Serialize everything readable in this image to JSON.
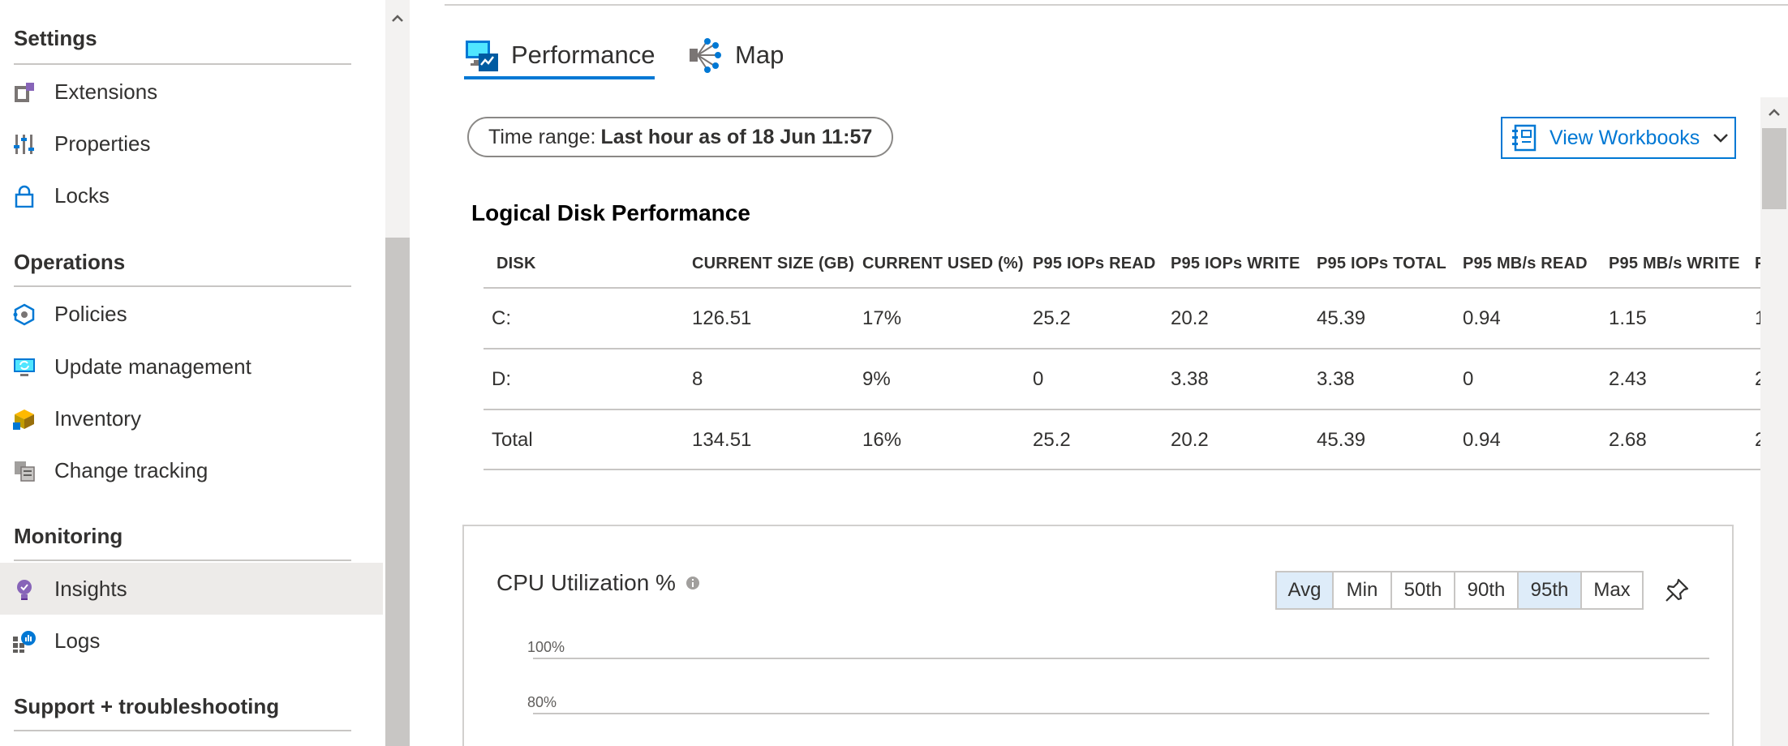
{
  "sidebar": {
    "sections": [
      {
        "title": "Settings",
        "items": [
          {
            "label": "Extensions",
            "icon": "extensions-icon"
          },
          {
            "label": "Properties",
            "icon": "properties-icon"
          },
          {
            "label": "Locks",
            "icon": "lock-icon"
          }
        ]
      },
      {
        "title": "Operations",
        "items": [
          {
            "label": "Policies",
            "icon": "policies-icon"
          },
          {
            "label": "Update management",
            "icon": "update-management-icon"
          },
          {
            "label": "Inventory",
            "icon": "inventory-icon"
          },
          {
            "label": "Change tracking",
            "icon": "change-tracking-icon"
          }
        ]
      },
      {
        "title": "Monitoring",
        "items": [
          {
            "label": "Insights",
            "icon": "insights-icon",
            "selected": true
          },
          {
            "label": "Logs",
            "icon": "logs-icon"
          }
        ]
      },
      {
        "title": "Support + troubleshooting",
        "items": []
      }
    ]
  },
  "tabs": [
    {
      "label": "Performance",
      "icon": "performance-icon",
      "active": true
    },
    {
      "label": "Map",
      "icon": "map-icon",
      "active": false
    }
  ],
  "toolbar": {
    "time_range_prefix": "Time range:",
    "time_range_value": "Last hour as of 18 Jun 11:57",
    "view_workbooks_label": "View Workbooks"
  },
  "disk_table": {
    "title": "Logical Disk Performance",
    "columns": [
      "DISK",
      "CURRENT SIZE (GB)",
      "CURRENT USED (%)",
      "P95 IOPs READ",
      "P95 IOPs WRITE",
      "P95 IOPs TOTAL",
      "P95 MB/s READ",
      "P95 MB/s WRITE",
      "P"
    ],
    "rows": [
      [
        "C:",
        "126.51",
        "17%",
        "25.2",
        "20.2",
        "45.39",
        "0.94",
        "1.15",
        "1"
      ],
      [
        "D:",
        "8",
        "9%",
        "0",
        "3.38",
        "3.38",
        "0",
        "2.43",
        "2"
      ],
      [
        "Total",
        "134.51",
        "16%",
        "25.2",
        "20.2",
        "45.39",
        "0.94",
        "2.68",
        "2"
      ]
    ]
  },
  "cpu_card": {
    "title": "CPU Utilization %",
    "aggregations": [
      {
        "label": "Avg",
        "selected": true
      },
      {
        "label": "Min",
        "selected": false
      },
      {
        "label": "50th",
        "selected": false
      },
      {
        "label": "90th",
        "selected": false
      },
      {
        "label": "95th",
        "selected": true
      },
      {
        "label": "Max",
        "selected": false
      }
    ],
    "y_ticks": [
      "100%",
      "80%"
    ]
  },
  "colors": {
    "accent": "#0078d4",
    "selected_nav_bg": "#edebe9",
    "selected_segment_bg": "#deecf9"
  }
}
